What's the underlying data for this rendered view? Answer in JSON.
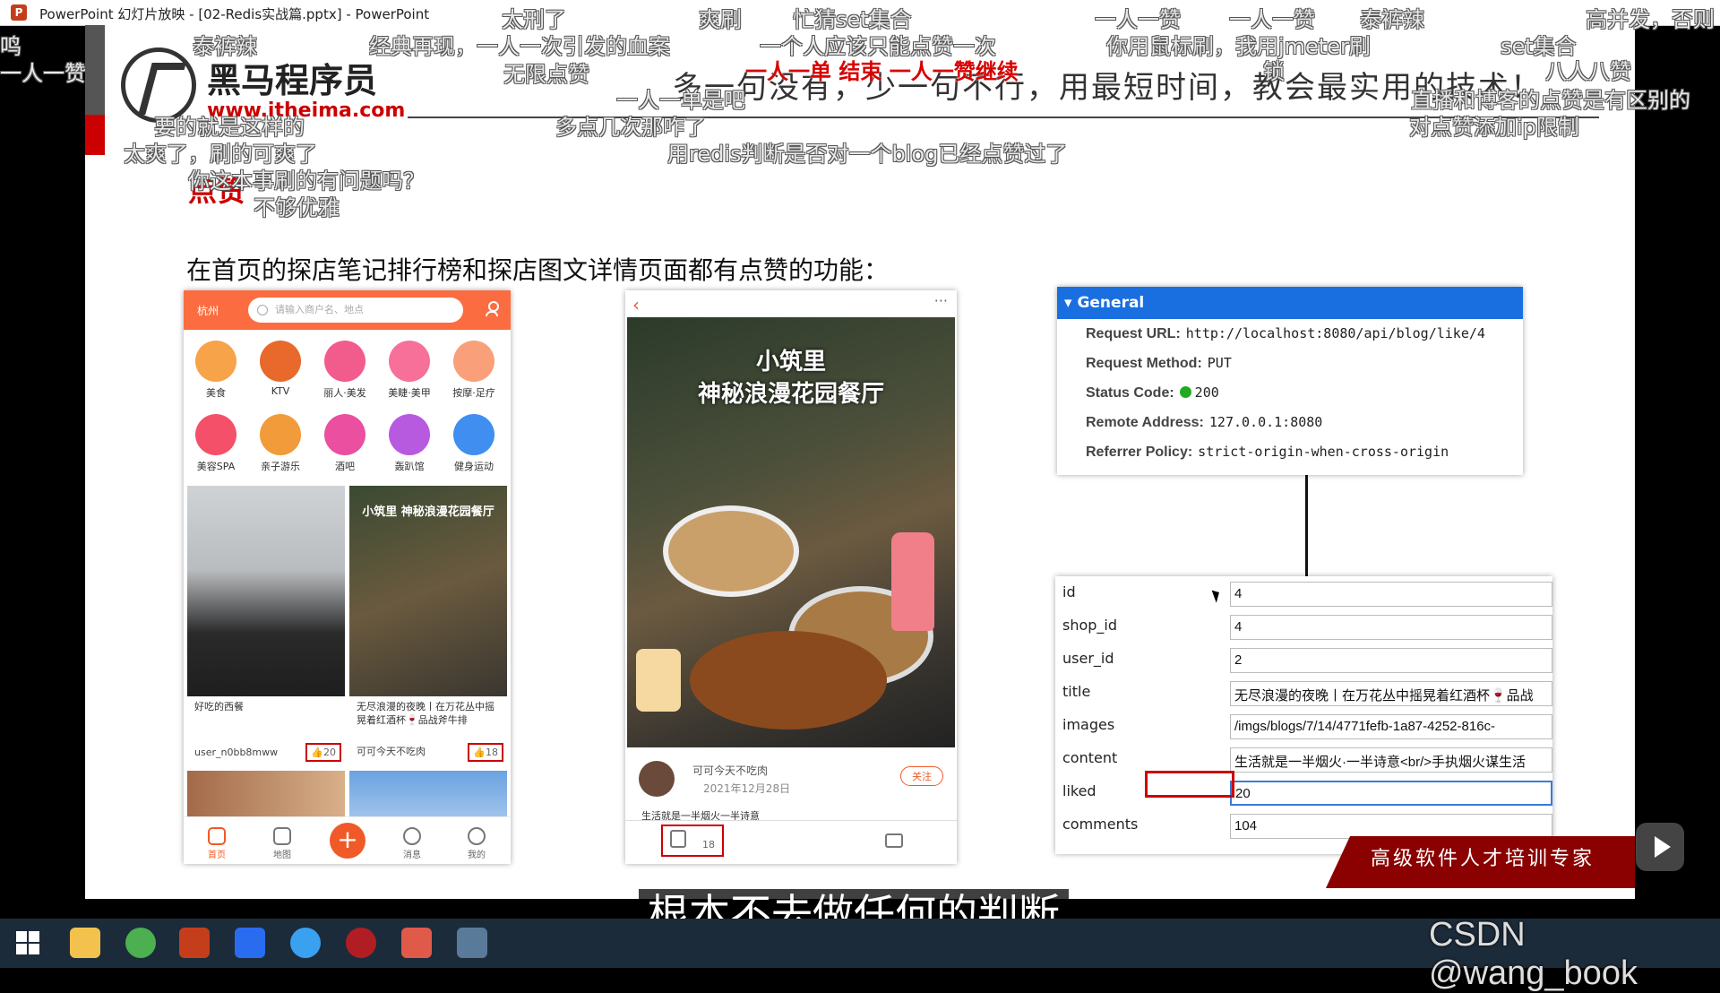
{
  "window": {
    "title": "PowerPoint 幻灯片放映 - [02-Redis实战篇.pptx] - PowerPoint"
  },
  "slide": {
    "brand": "黑马程序员",
    "url": "www.itheima.com",
    "slogan": "多一句没有，少一句不行，用最短时间，教会最实用的技术！",
    "heading": "点赞",
    "subheading": "在首页的探店笔记排行榜和探店图文详情页面都有点赞的功能："
  },
  "phone1": {
    "city": "杭州",
    "search_placeholder": "请输入商户名、地点",
    "categories": [
      "美食",
      "KTV",
      "丽人·美发",
      "美睫·美甲",
      "按摩·足疗",
      "美容SPA",
      "亲子游乐",
      "酒吧",
      "轰趴馆",
      "健身运动"
    ],
    "cards": [
      {
        "title": "好吃的西餐",
        "user": "user_n0bb8mww",
        "likes": "20"
      },
      {
        "title": "无尽浪漫的夜晚丨在万花丛中摇晃着红酒杯🍷品战斧牛排",
        "user": "可可今天不吃肉",
        "likes": "18"
      }
    ],
    "card2_overlay": "小筑里 神秘浪漫花园餐厅",
    "nav": [
      "首页",
      "地图",
      "消息",
      "我的"
    ]
  },
  "phone2": {
    "image_title_1": "小筑里",
    "image_title_2": "神秘浪漫花园餐厅",
    "author": "可可今天不吃肉",
    "date": "2021年12月28日",
    "follow": "关注",
    "excerpt": "生活就是一半烟火一半诗意",
    "likes": "18"
  },
  "general": {
    "header": "General",
    "rows": [
      {
        "k": "Request URL:",
        "v": "http://localhost:8080/api/blog/like/4"
      },
      {
        "k": "Request Method:",
        "v": "PUT"
      },
      {
        "k": "Status Code:",
        "v": "200"
      },
      {
        "k": "Remote Address:",
        "v": "127.0.0.1:8080"
      },
      {
        "k": "Referrer Policy:",
        "v": "strict-origin-when-cross-origin"
      }
    ]
  },
  "form": {
    "rows": [
      {
        "label": "id",
        "value": "4"
      },
      {
        "label": "shop_id",
        "value": "4"
      },
      {
        "label": "user_id",
        "value": "2"
      },
      {
        "label": "title",
        "value": "无尽浪漫的夜晚丨在万花丛中摇晃着红酒杯🍷品战"
      },
      {
        "label": "images",
        "value": "/imgs/blogs/7/14/4771fefb-1a87-4252-816c-"
      },
      {
        "label": "content",
        "value": "生活就是一半烟火·一半诗意<br/>手执烟火谋生活"
      },
      {
        "label": "liked",
        "value": "20"
      },
      {
        "label": "comments",
        "value": "104"
      }
    ]
  },
  "corner_banner": "高级软件人才培训专家",
  "subtitle": "根本不去做任何的判断",
  "watermark": "CSDN @wang_book",
  "danmaku": [
    "太刑了",
    "爽刷",
    "忙猜set集合",
    "一人一赞",
    "一人一赞",
    "泰裤辣",
    "高并发，否则",
    "泰裤辣",
    "经典再现，一人一次引发的血案",
    "一个人应该只能点赞一次",
    "你用鼠标刷，我用jmeter刷",
    "set集合",
    "无限点赞",
    "一人一单  结束  一人一赞继续",
    "锁",
    "八人八赞",
    "直播和博客的点赞是有区别的",
    "一人一单是吧",
    "一人一赞",
    "要的就是这样的",
    "多点几次那咋了",
    "对点赞添加ip限制",
    "太爽了，刷的可爽了",
    "用redis判断是否对一个blog已经点赞过了",
    "你这本事刷的有问题吗？",
    "不够优雅",
    "鸣"
  ]
}
